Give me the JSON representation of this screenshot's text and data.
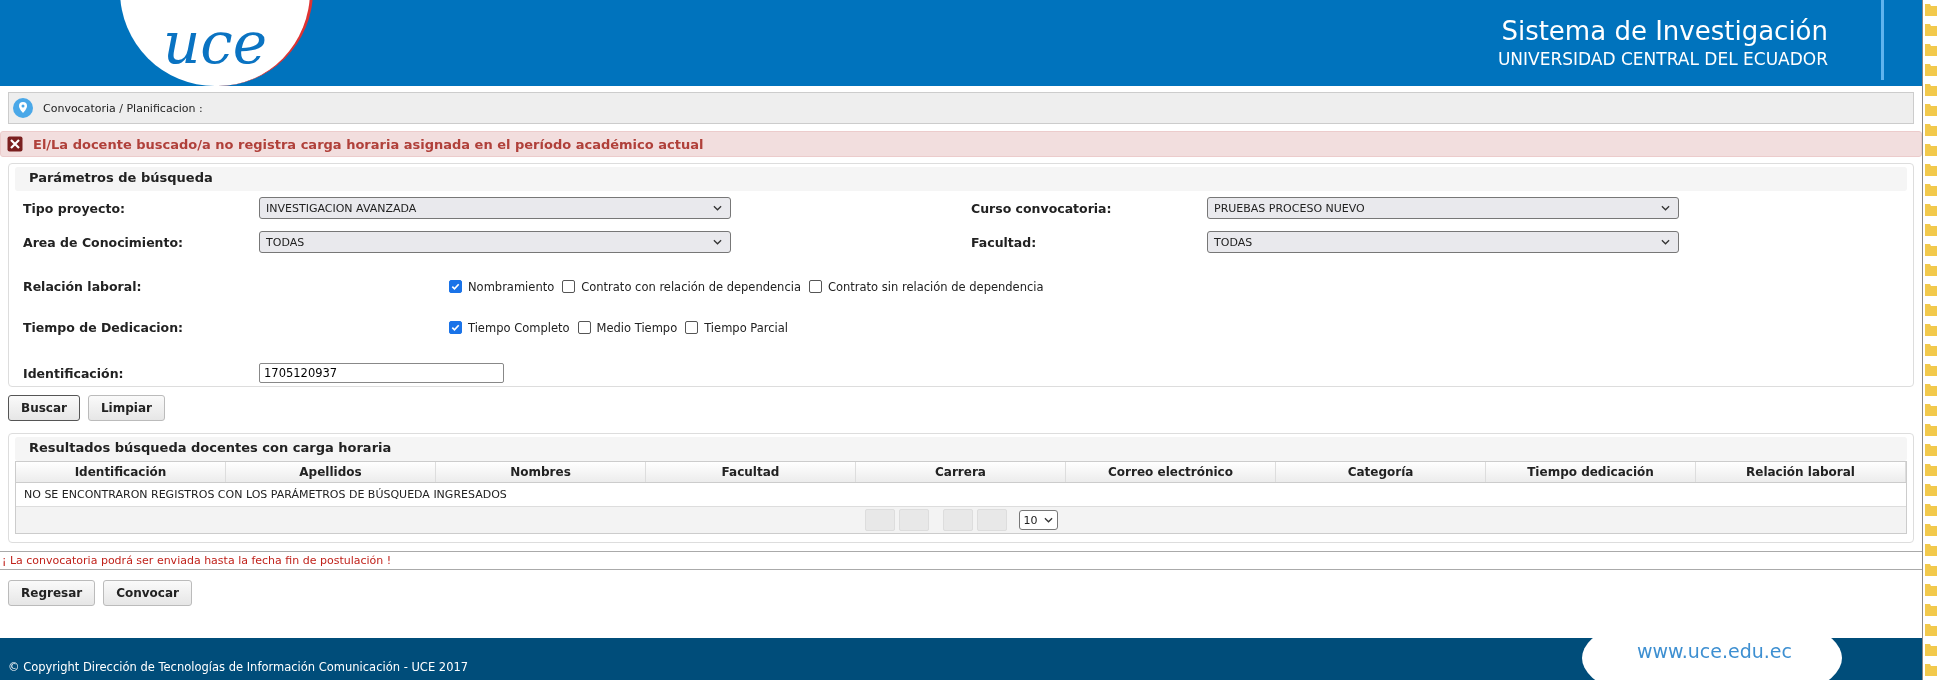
{
  "header": {
    "logo_text": "uce",
    "title": "Sistema de Investigación",
    "subtitle": "UNIVERSIDAD CENTRAL DEL ECUADOR"
  },
  "breadcrumb": "Convocatoria / Planificacion :",
  "error_message": "El/La docente buscado/a no registra carga horaria asignada en el período académico actual",
  "search_panel": {
    "title": "Parámetros de búsqueda",
    "selects": [
      {
        "label": "Tipo proyecto:",
        "value": "INVESTIGACION AVANZADA"
      },
      {
        "label": "Curso convocatoria:",
        "value": "PRUEBAS PROCESO NUEVO"
      },
      {
        "label": "Area de Conocimiento:",
        "value": "TODAS"
      },
      {
        "label": "Facultad:",
        "value": "TODAS"
      }
    ],
    "checkbox_groups": [
      {
        "label": "Relación laboral:",
        "options": [
          {
            "label": "Nombramiento",
            "checked": true
          },
          {
            "label": "Contrato con relación de dependencia",
            "checked": false
          },
          {
            "label": "Contrato sin relación de dependencia",
            "checked": false
          }
        ]
      },
      {
        "label": "Tiempo de Dedicacion:",
        "options": [
          {
            "label": "Tiempo Completo",
            "checked": true
          },
          {
            "label": "Medio Tiempo",
            "checked": false
          },
          {
            "label": "Tiempo Parcial",
            "checked": false
          }
        ]
      }
    ],
    "id_field": {
      "label": "Identificación:",
      "value": "1705120937"
    }
  },
  "search_buttons": [
    "Buscar",
    "Limpiar"
  ],
  "results": {
    "title": "Resultados búsqueda docentes con carga horaria",
    "columns": [
      "Identificación",
      "Apellidos",
      "Nombres",
      "Facultad",
      "Carrera",
      "Correo electrónico",
      "Categoría",
      "Tiempo dedicación",
      "Relación laboral"
    ],
    "empty_message": "NO SE ENCONTRARON REGISTROS CON LOS PARÁMETROS DE BÚSQUEDA INGRESADOS",
    "page_size": "10"
  },
  "notice": "¡ La convocatoria podrá ser enviada hasta la fecha fin de postulación !",
  "action_buttons": [
    "Regresar",
    "Convocar"
  ],
  "footer": {
    "copyright": "© Copyright Dirección de Tecnologías de Información Comunicación - UCE 2017",
    "website": "www.uce.edu.ec"
  }
}
